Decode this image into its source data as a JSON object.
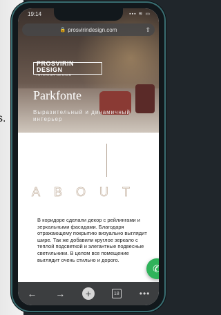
{
  "background": {
    "outside_text": "s."
  },
  "status_bar": {
    "time": "19:14",
    "icons": "▪▪▪ ≋ ▭"
  },
  "browser": {
    "url": "prosvirindesign.com"
  },
  "hero": {
    "logo_main": "PROSVIRIN DESIGN",
    "logo_sub": "INTERIOR DESIGN",
    "title": "Parkfonte",
    "subtitle": "Выразительный и динамичный интерьер"
  },
  "about": {
    "heading": "ABOUT",
    "paragraph": "В коридоре сделали декор с рейлингами и зеркальными фасадами. Благодаря отражающему покрытию визуально выглядит шире. Так же добавили круглое зеркало с теплой подсветкой и элегантные подвесные светильники. В целом все помещение выглядит очень стильно и дорого."
  },
  "toolbar": {
    "back": "←",
    "forward": "→",
    "new_tab": "+",
    "tab_count": "18",
    "more": "•••"
  },
  "colors": {
    "accent_green": "#2fb35a",
    "toolbar_bg": "#3c3e40"
  }
}
